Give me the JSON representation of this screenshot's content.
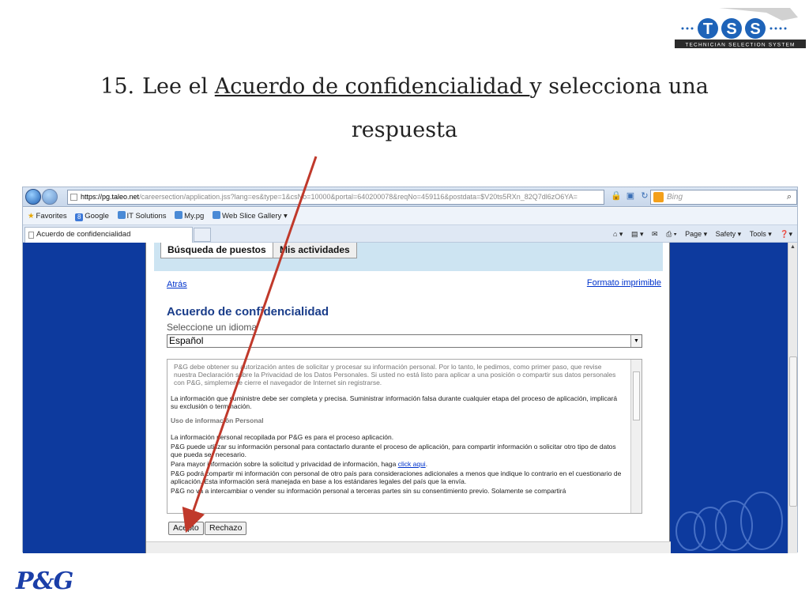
{
  "slide": {
    "number": "15.",
    "title_before": "Lee el ",
    "title_link": "Acuerdo de confidencialidad ",
    "title_after": "y selecciona una",
    "title_line2": "respuesta"
  },
  "logos": {
    "tss_tagline": "TECHNICIAN SELECTION SYSTEM",
    "tss_letters": [
      "T",
      "S",
      "S"
    ],
    "pg": "P&G"
  },
  "browser": {
    "url_host": "https://pg.taleo.net",
    "url_rest": "/careersection/application.jss?lang=es&type=1&csNo=10000&portal=640200078&reqNo=459116&postdata=$V20ts5RXn_82Q7dl6zO6YA=",
    "search_placeholder": "Bing",
    "favorites": [
      "Favorites",
      "Google",
      "IT Solutions",
      "My.pg",
      "Web Slice Gallery"
    ],
    "tab_title": "Acuerdo de confidencialidad",
    "commands": [
      "Page ▾",
      "Safety ▾",
      "Tools ▾"
    ]
  },
  "page": {
    "tabs": [
      "Búsqueda de puestos",
      "Mis actividades"
    ],
    "back_link": "Atrás",
    "print_link": "Formato imprimible",
    "heading": "Acuerdo de confidencialidad",
    "lang_label": "Seleccione un idioma",
    "lang_value": "Español",
    "intro": "P&G debe obtener su autorización antes de solicitar y procesar su información personal. Por lo tanto, le pedimos, como primer paso, que revise nuestra Declaración sobre la Privacidad de los Datos Personales. Si usted no está listo para aplicar a una posición o compartir sus datos personales con P&G, simplemente cierre el navegador de Internet sin registrarse.",
    "para1": "La información que suministre debe ser completa y precisa. Suministrar información falsa durante cualquier etapa del proceso de aplicación, implicará su exclusión o terminación.",
    "section_title": "Uso de información Personal",
    "line1": "La información personal recopilada por P&G es para el proceso aplicación.",
    "line2": "P&G puede utilizar su información personal para contactarlo durante el proceso de aplicación, para compartir información o solicitar otro tipo de datos que pueda ser necesario.",
    "line3_before": "Para mayor información sobre la solicitud y privacidad de información, haga ",
    "line3_link": "click aqui",
    "line3_after": ".",
    "line4": "P&G podrá compartir mi información con personal de otro país para consideraciones adicionales a menos que indique lo contrario en el cuestionario de aplicación. Esta información será manejada en base a los estándares legales del país que la envía.",
    "line5": "P&G no va a intercambiar o vender su información personal a terceras partes sin su consentimiento previo. Solamente se compartirá",
    "accept": "Acepto",
    "reject": "Rechazo"
  },
  "colors": {
    "page_bg": "#0d3a9e",
    "heading": "#1a3d8a",
    "arrow": "#c0392b",
    "pg_blue": "#1a3ea8"
  }
}
